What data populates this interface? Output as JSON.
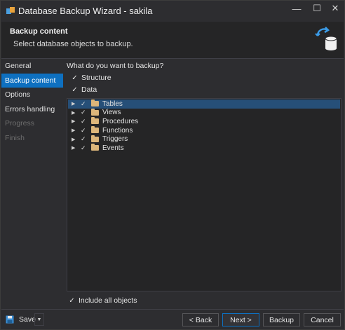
{
  "window": {
    "title": "Database Backup Wizard - sakila",
    "minimize": "—",
    "maximize": "☐",
    "close": "✕"
  },
  "header": {
    "title": "Backup content",
    "subtitle": "Select database objects to backup."
  },
  "sidebar": {
    "items": [
      {
        "label": "General",
        "state": "normal"
      },
      {
        "label": "Backup content",
        "state": "active"
      },
      {
        "label": "Options",
        "state": "normal"
      },
      {
        "label": "Errors handling",
        "state": "normal"
      },
      {
        "label": "Progress",
        "state": "disabled"
      },
      {
        "label": "Finish",
        "state": "disabled"
      }
    ]
  },
  "main": {
    "prompt": "What do you want to backup?",
    "structure_label": "Structure",
    "structure_checked": true,
    "data_label": "Data",
    "data_checked": true,
    "tree": [
      {
        "label": "Tables",
        "checked": true,
        "selected": true
      },
      {
        "label": "Views",
        "checked": true,
        "selected": false
      },
      {
        "label": "Procedures",
        "checked": true,
        "selected": false
      },
      {
        "label": "Functions",
        "checked": true,
        "selected": false
      },
      {
        "label": "Triggers",
        "checked": true,
        "selected": false
      },
      {
        "label": "Events",
        "checked": true,
        "selected": false
      }
    ],
    "include_all_label": "Include all objects",
    "include_all_checked": true
  },
  "footer": {
    "save_label": "Save",
    "back_label": "< Back",
    "next_label": "Next >",
    "backup_label": "Backup",
    "cancel_label": "Cancel"
  },
  "colors": {
    "accent": "#0e70c0",
    "selection": "#264f78",
    "background": "#2d2d30",
    "folder": "#dcb67a"
  }
}
